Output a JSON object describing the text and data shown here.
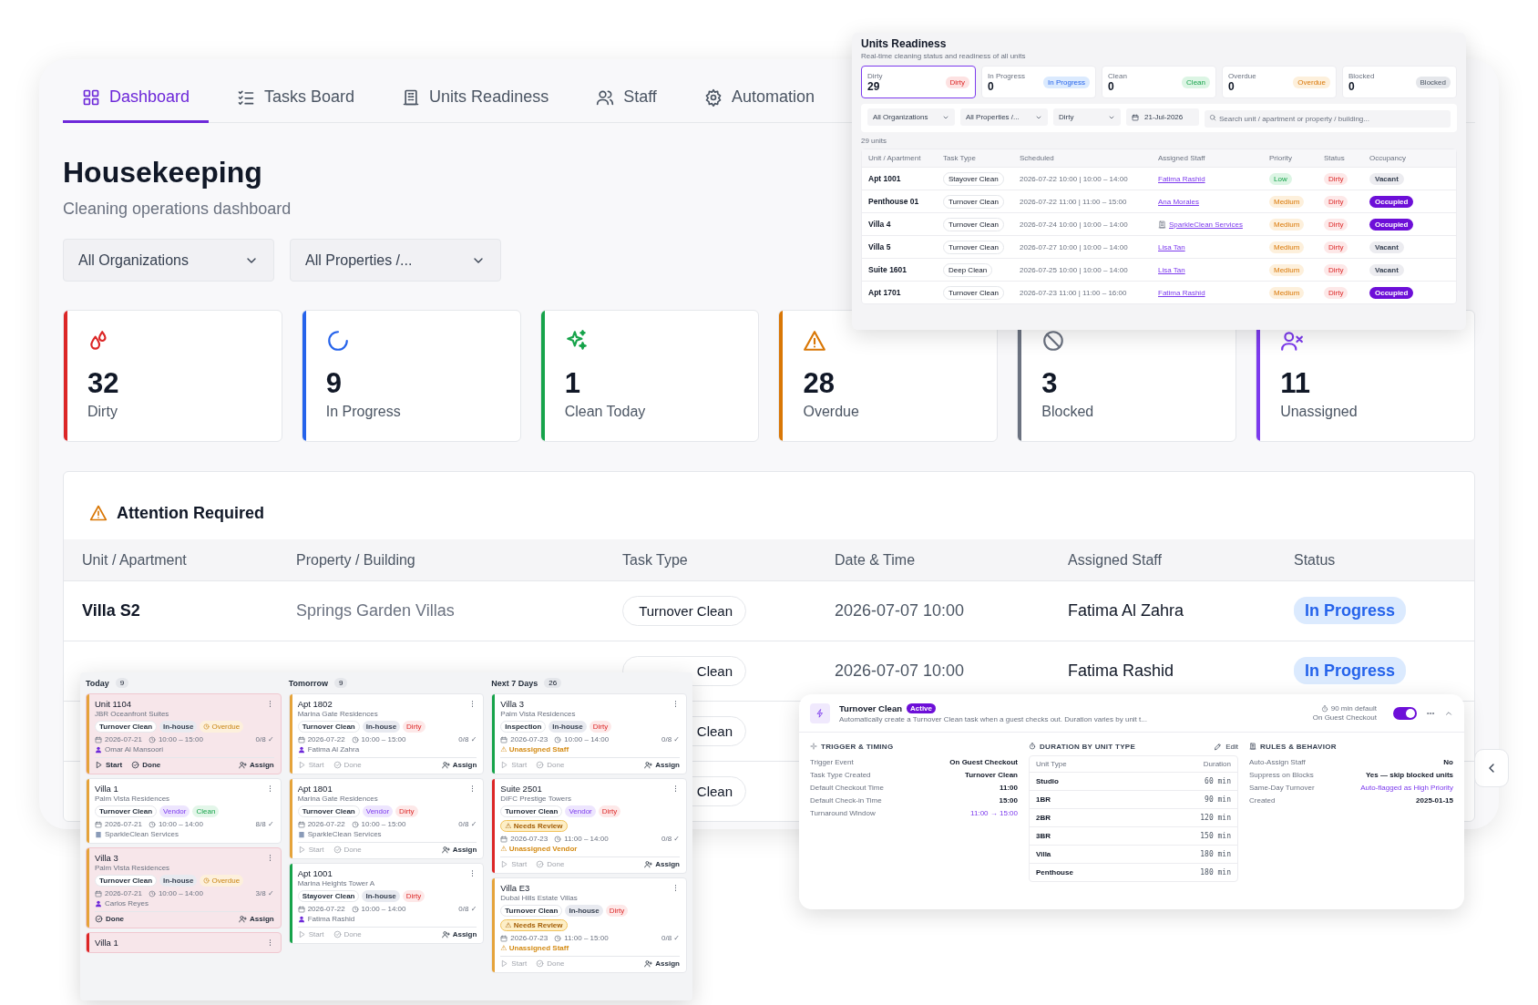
{
  "tabs": [
    {
      "label": "Dashboard",
      "selected": true
    },
    {
      "label": "Tasks Board",
      "selected": false
    },
    {
      "label": "Units Readiness",
      "selected": false
    },
    {
      "label": "Staff",
      "selected": false
    },
    {
      "label": "Automation",
      "selected": false
    }
  ],
  "page": {
    "title": "Housekeeping",
    "subtitle": "Cleaning operations dashboard"
  },
  "filters": [
    {
      "label": "All Organizations"
    },
    {
      "label": "All Properties /..."
    }
  ],
  "stats": [
    {
      "kind": "dirty",
      "value": "32",
      "label": "Dirty",
      "color": "#dc2626"
    },
    {
      "kind": "progress",
      "value": "9",
      "label": "In Progress",
      "color": "#2563eb"
    },
    {
      "kind": "clean",
      "value": "1",
      "label": "Clean Today",
      "color": "#16a34a"
    },
    {
      "kind": "overdue",
      "value": "28",
      "label": "Overdue",
      "color": "#d97706"
    },
    {
      "kind": "blocked",
      "value": "3",
      "label": "Blocked",
      "color": "#6b7280"
    },
    {
      "kind": "unassigned",
      "value": "11",
      "label": "Unassigned",
      "color": "#7c3aed"
    }
  ],
  "attention": {
    "title": "Attention Required",
    "columns": [
      "Unit / Apartment",
      "Property / Building",
      "Task Type",
      "Date & Time",
      "Assigned Staff",
      "Status"
    ],
    "rows": [
      {
        "unit": "Villa S2",
        "property": "Springs Garden Villas",
        "task_type": "Turnover Clean",
        "date_time": "2026-07-07 10:00",
        "staff": "Fatima Al Zahra",
        "status": "In Progress"
      },
      {
        "task_type": "Clean",
        "date_time": "2026-07-07 10:00",
        "staff": "Fatima Rashid",
        "status": "In Progress"
      },
      {
        "task_type": "Clean"
      },
      {
        "task_type": "Clean"
      }
    ]
  },
  "units_readiness": {
    "title": "Units Readiness",
    "subtitle": "Real-time cleaning status and readiness of all units",
    "summary": [
      {
        "label": "Dirty",
        "value": "29",
        "badge": "Dirty",
        "kind": "dirty",
        "selected": true
      },
      {
        "label": "In Progress",
        "value": "0",
        "badge": "In Progress",
        "kind": "progress",
        "selected": false
      },
      {
        "label": "Clean",
        "value": "0",
        "badge": "Clean",
        "kind": "clean",
        "selected": false
      },
      {
        "label": "Overdue",
        "value": "0",
        "badge": "Overdue",
        "kind": "overdue",
        "selected": false
      },
      {
        "label": "Blocked",
        "value": "0",
        "badge": "Blocked",
        "kind": "blocked",
        "selected": false
      }
    ],
    "filters": {
      "organization": "All Organizations",
      "property": "All Properties /...",
      "status": "Dirty",
      "date": "21-Jul-2026",
      "search_placeholder": "Search unit / apartment or property / building..."
    },
    "count": "29 units",
    "columns": [
      "Unit / Apartment",
      "Task Type",
      "Scheduled",
      "Assigned Staff",
      "Priority",
      "Status",
      "Occupancy"
    ],
    "rows": [
      {
        "unit": "Apt 1001",
        "task_type": "Stayover Clean",
        "scheduled": "2026-07-22 10:00 | 10:00 – 14:00",
        "staff": {
          "text": "Fatima Rashid",
          "kind": "person"
        },
        "priority": {
          "text": "Low",
          "kind": "low"
        },
        "status": "Dirty",
        "occupancy": {
          "text": "Vacant",
          "occupied": false
        }
      },
      {
        "unit": "Penthouse 01",
        "task_type": "Turnover Clean",
        "scheduled": "2026-07-22 11:00 | 11:00 – 15:00",
        "staff": {
          "text": "Ana Morales",
          "kind": "person"
        },
        "priority": {
          "text": "Medium",
          "kind": "medium"
        },
        "status": "Dirty",
        "occupancy": {
          "text": "Occupied",
          "occupied": true
        }
      },
      {
        "unit": "Villa 4",
        "task_type": "Turnover Clean",
        "scheduled": "2026-07-24 10:00 | 10:00 – 14:00",
        "staff": {
          "text": "SparkleClean Services",
          "kind": "vendor"
        },
        "priority": {
          "text": "Medium",
          "kind": "medium"
        },
        "status": "Dirty",
        "occupancy": {
          "text": "Occupied",
          "occupied": true
        }
      },
      {
        "unit": "Villa 5",
        "task_type": "Turnover Clean",
        "scheduled": "2026-07-27 10:00 | 10:00 – 14:00",
        "staff": {
          "text": "Lisa Tan",
          "kind": "person"
        },
        "priority": {
          "text": "Medium",
          "kind": "medium"
        },
        "status": "Dirty",
        "occupancy": {
          "text": "Vacant",
          "occupied": false
        }
      },
      {
        "unit": "Suite 1601",
        "task_type": "Deep Clean",
        "scheduled": "2026-07-25 10:00 | 10:00 – 14:00",
        "staff": {
          "text": "Lisa Tan",
          "kind": "person"
        },
        "priority": {
          "text": "Medium",
          "kind": "medium"
        },
        "status": "Dirty",
        "occupancy": {
          "text": "Vacant",
          "occupied": false
        }
      },
      {
        "unit": "Apt 1701",
        "task_type": "Turnover Clean",
        "scheduled": "2026-07-23 11:00 | 11:00 – 16:00",
        "staff": {
          "text": "Fatima Rashid",
          "kind": "person"
        },
        "priority": {
          "text": "Medium",
          "kind": "medium"
        },
        "status": "Dirty",
        "occupancy": {
          "text": "Occupied",
          "occupied": true
        }
      }
    ]
  },
  "board": {
    "columns": [
      {
        "title": "Today",
        "count": "9",
        "cards": [
          {
            "unit": "Unit 1104",
            "property": "JBR Oceanfront Suites",
            "color": "#e5a33a",
            "flagged": true,
            "tags": [
              {
                "text": "Turnover Clean",
                "kind": "task"
              },
              {
                "text": "In-house",
                "kind": "inhouse"
              },
              {
                "text": "Overdue",
                "kind": "overdue"
              }
            ],
            "date": "2026-07-21",
            "time": "10:00 – 15:00",
            "progress": "0/8 ✓",
            "assignee": {
              "kind": "person",
              "text": "Omar Al Mansoori"
            },
            "actions": [
              {
                "kind": "start",
                "label": "Start",
                "disabled": false
              },
              {
                "kind": "done",
                "label": "Done",
                "disabled": false
              },
              {
                "kind": "assign",
                "label": "Assign",
                "disabled": false
              }
            ]
          },
          {
            "unit": "Villa 1",
            "property": "Palm Vista Residences",
            "color": "#e5a33a",
            "flagged": false,
            "tags": [
              {
                "text": "Turnover Clean",
                "kind": "task"
              },
              {
                "text": "Vendor",
                "kind": "vendor"
              },
              {
                "text": "Clean",
                "kind": "clean"
              }
            ],
            "date": "2026-07-21",
            "time": "10:00 – 14:00",
            "progress": "8/8 ✓",
            "assignee": {
              "kind": "vendor",
              "text": "SparkleClean Services"
            }
          },
          {
            "unit": "Villa 3",
            "property": "Palm Vista Residences",
            "color": "#e5a33a",
            "flagged": true,
            "tags": [
              {
                "text": "Turnover Clean",
                "kind": "task"
              },
              {
                "text": "In-house",
                "kind": "inhouse"
              },
              {
                "text": "Overdue",
                "kind": "overdue"
              }
            ],
            "date": "2026-07-21",
            "time": "10:00 – 14:00",
            "progress": "3/8 ✓",
            "assignee": {
              "kind": "person",
              "text": "Carlos Reyes"
            },
            "actions": [
              {
                "kind": "done",
                "label": "Done",
                "disabled": false
              },
              {
                "kind": "assign",
                "label": "Assign",
                "disabled": false
              }
            ]
          },
          {
            "unit": "Villa 1",
            "color": "#dc2626",
            "flagged": true
          }
        ]
      },
      {
        "title": "Tomorrow",
        "count": "9",
        "cards": [
          {
            "unit": "Apt 1802",
            "property": "Marina Gate Residences",
            "color": "#e5a33a",
            "flagged": false,
            "tags": [
              {
                "text": "Turnover Clean",
                "kind": "task"
              },
              {
                "text": "In-house",
                "kind": "inhouse"
              },
              {
                "text": "Dirty",
                "kind": "dirty"
              }
            ],
            "date": "2026-07-22",
            "time": "10:00 – 15:00",
            "progress": "0/8 ✓",
            "assignee": {
              "kind": "person",
              "text": "Fatima Al Zahra"
            },
            "actions": [
              {
                "kind": "start",
                "label": "Start",
                "disabled": true
              },
              {
                "kind": "done",
                "label": "Done",
                "disabled": true
              },
              {
                "kind": "assign",
                "label": "Assign",
                "disabled": false
              }
            ]
          },
          {
            "unit": "Apt 1801",
            "property": "Marina Gate Residences",
            "color": "#e5a33a",
            "flagged": false,
            "tags": [
              {
                "text": "Turnover Clean",
                "kind": "task"
              },
              {
                "text": "Vendor",
                "kind": "vendor"
              },
              {
                "text": "Dirty",
                "kind": "dirty"
              }
            ],
            "date": "2026-07-22",
            "time": "10:00 – 15:00",
            "progress": "0/8 ✓",
            "assignee": {
              "kind": "vendor",
              "text": "SparkleClean Services"
            },
            "actions": [
              {
                "kind": "start",
                "label": "Start",
                "disabled": true
              },
              {
                "kind": "done",
                "label": "Done",
                "disabled": true
              },
              {
                "kind": "assign",
                "label": "Assign",
                "disabled": false
              }
            ]
          },
          {
            "unit": "Apt 1001",
            "property": "Marina Heights Tower A",
            "color": "#16a34a",
            "flagged": false,
            "tags": [
              {
                "text": "Stayover Clean",
                "kind": "task"
              },
              {
                "text": "In-house",
                "kind": "inhouse"
              },
              {
                "text": "Dirty",
                "kind": "dirty"
              }
            ],
            "date": "2026-07-22",
            "time": "10:00 – 14:00",
            "progress": "0/8 ✓",
            "assignee": {
              "kind": "person",
              "text": "Fatima Rashid"
            },
            "actions": [
              {
                "kind": "start",
                "label": "Start",
                "disabled": true
              },
              {
                "kind": "done",
                "label": "Done",
                "disabled": true
              },
              {
                "kind": "assign",
                "label": "Assign",
                "disabled": false
              }
            ]
          }
        ]
      },
      {
        "title": "Next 7 Days",
        "count": "26",
        "cards": [
          {
            "unit": "Villa 3",
            "property": "Palm Vista Residences",
            "color": "#16a34a",
            "flagged": false,
            "tags": [
              {
                "text": "Inspection",
                "kind": "task"
              },
              {
                "text": "In-house",
                "kind": "inhouse"
              },
              {
                "text": "Dirty",
                "kind": "dirty"
              }
            ],
            "date": "2026-07-23",
            "time": "10:00 – 14:00",
            "progress": "0/8 ✓",
            "assignee": {
              "kind": "warning",
              "text": "⚠ Unassigned Staff"
            },
            "actions": [
              {
                "kind": "start",
                "label": "Start",
                "disabled": true
              },
              {
                "kind": "done",
                "label": "Done",
                "disabled": true
              },
              {
                "kind": "assign",
                "label": "Assign",
                "disabled": false
              }
            ]
          },
          {
            "unit": "Suite 2501",
            "property": "DIFC Prestige Towers",
            "color": "#dc2626",
            "flagged": false,
            "tags": [
              {
                "text": "Turnover Clean",
                "kind": "task"
              },
              {
                "text": "Vendor",
                "kind": "vendor"
              },
              {
                "text": "Dirty",
                "kind": "dirty"
              },
              {
                "text": "⚠ Needs Review",
                "kind": "review"
              }
            ],
            "date": "2026-07-23",
            "time": "11:00 – 14:00",
            "progress": "0/8 ✓",
            "assignee": {
              "kind": "warning",
              "text": "⚠ Unassigned Vendor"
            },
            "actions": [
              {
                "kind": "start",
                "label": "Start",
                "disabled": true
              },
              {
                "kind": "done",
                "label": "Done",
                "disabled": true
              },
              {
                "kind": "assign",
                "label": "Assign",
                "disabled": false
              }
            ]
          },
          {
            "unit": "Villa E3",
            "property": "Dubai Hills Estate Villas",
            "color": "#e5a33a",
            "flagged": false,
            "tags": [
              {
                "text": "Turnover Clean",
                "kind": "task"
              },
              {
                "text": "In-house",
                "kind": "inhouse"
              },
              {
                "text": "Dirty",
                "kind": "dirty"
              },
              {
                "text": "⚠ Needs Review",
                "kind": "review"
              }
            ],
            "date": "2026-07-23",
            "time": "11:00 – 15:00",
            "progress": "0/8 ✓",
            "assignee": {
              "kind": "warning",
              "text": "⚠ Unassigned Staff"
            },
            "actions": [
              {
                "kind": "start",
                "label": "Start",
                "disabled": true
              },
              {
                "kind": "done",
                "label": "Done",
                "disabled": true
              },
              {
                "kind": "assign",
                "label": "Assign",
                "disabled": false
              }
            ]
          }
        ]
      }
    ]
  },
  "automation": {
    "title": "Turnover Clean",
    "badge": "Active",
    "description": "Automatically create a Turnover Clean task when a guest checks out. Duration varies by unit t...",
    "duration": "90 min default",
    "trigger": "On Guest Checkout",
    "on": true,
    "trigger_timing": {
      "title": "TRIGGER & TIMING",
      "rows": [
        {
          "label": "Trigger Event",
          "value": "On Guest Checkout",
          "highlight": false
        },
        {
          "label": "Task Type Created",
          "value": "Turnover Clean",
          "highlight": false
        },
        {
          "label": "Default Checkout Time",
          "value": "11:00",
          "highlight": false
        },
        {
          "label": "Default Check-in Time",
          "value": "15:00",
          "highlight": false
        },
        {
          "label": "Turnaround Window",
          "value": "11:00 → 15:00",
          "highlight": true
        }
      ]
    },
    "durations": {
      "title": "DURATION BY UNIT TYPE",
      "edit": "Edit",
      "columns": [
        "Unit Type",
        "Duration"
      ],
      "rows": [
        {
          "unit_type": "Studio",
          "duration": "60 min"
        },
        {
          "unit_type": "1BR",
          "duration": "90 min"
        },
        {
          "unit_type": "2BR",
          "duration": "120 min"
        },
        {
          "unit_type": "3BR",
          "duration": "150 min"
        },
        {
          "unit_type": "Villa",
          "duration": "180 min"
        },
        {
          "unit_type": "Penthouse",
          "duration": "180 min"
        }
      ]
    },
    "rules": {
      "title": "RULES & BEHAVIOR",
      "rows": [
        {
          "label": "Auto-Assign Staff",
          "value": "No",
          "highlight": false
        },
        {
          "label": "Suppress on Blocks",
          "value": "Yes — skip blocked units",
          "highlight": false
        },
        {
          "label": "Same-Day Turnover",
          "value": "Auto-flagged as High Priority",
          "highlight": true
        },
        {
          "label": "Created",
          "value": "2025-01-15",
          "highlight": false
        }
      ]
    }
  }
}
